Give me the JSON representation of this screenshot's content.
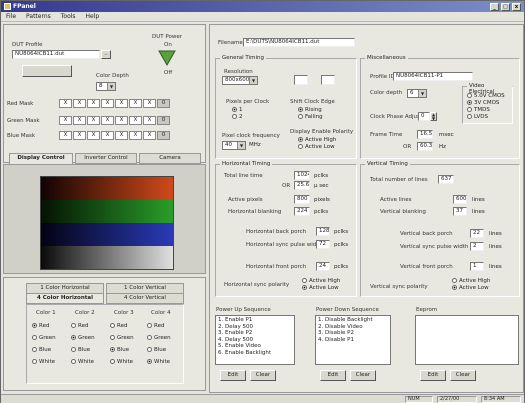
{
  "window": {
    "title": "FPanel",
    "min": "_",
    "max": "□",
    "close": "x"
  },
  "menu": [
    "File",
    "Patterns",
    "Tools",
    "Help"
  ],
  "left": {
    "dut_profile_label": "DUT Profile",
    "dut_profile_value": "NU8064ICB11.dut",
    "dut_power_label": "DUT Power",
    "dut_power_on": "On",
    "dut_power_off": "Off",
    "color_depth_label": "Color Depth",
    "color_depth_value": "8",
    "mask_rows": [
      {
        "label": "Red Mask",
        "cells": [
          "X",
          "X",
          "X",
          "X",
          "X",
          "X",
          "X",
          "0"
        ]
      },
      {
        "label": "Green Mask",
        "cells": [
          "X",
          "X",
          "X",
          "X",
          "X",
          "X",
          "X",
          "0"
        ]
      },
      {
        "label": "Blue Mask",
        "cells": [
          "X",
          "X",
          "X",
          "X",
          "X",
          "X",
          "X",
          "0"
        ]
      }
    ],
    "tabs": [
      "Display Control",
      "Inverter Control",
      "Camera"
    ],
    "pattern_tabs_top": [
      "1 Color Horizontal",
      "1 Color Vertical"
    ],
    "pattern_tabs_bottom": [
      "4 Color Horizontal",
      "4 Color Vertical"
    ],
    "color_columns": [
      {
        "title": "Color 1",
        "options": [
          "Red",
          "Green",
          "Blue",
          "White"
        ],
        "selected": "Red"
      },
      {
        "title": "Color 2",
        "options": [
          "Red",
          "Green",
          "Blue",
          "White"
        ],
        "selected": "Green"
      },
      {
        "title": "Color 3",
        "options": [
          "Red",
          "Green",
          "Blue",
          "White"
        ],
        "selected": "Blue"
      },
      {
        "title": "Color 4",
        "options": [
          "Red",
          "Green",
          "Blue",
          "White"
        ],
        "selected": "White"
      }
    ]
  },
  "filename_label": "Filename",
  "filename_value": "E:\\DUTS\\NU8064ICB11.dut",
  "general_timing": {
    "title": "General Timing",
    "resolution_label": "Resolution",
    "resolution_value": "800x600",
    "pixels_per_clock_label": "Pixels per Clock",
    "ppc_options": [
      "1",
      "2"
    ],
    "ppc_selected": "1",
    "shift_clock_label": "Shift Clock Edge",
    "edge_options": [
      "Rising",
      "Falling"
    ],
    "edge_selected": "Rising",
    "pixel_freq_label": "Pixel clock frequency",
    "pixel_freq_value": "40",
    "pixel_freq_unit": "MHz",
    "display_enable_label": "Display Enable Polarity",
    "de_options": [
      "Active High",
      "Active Low"
    ],
    "de_selected": "Active High"
  },
  "misc": {
    "title": "Miscellaneous",
    "profile_id_label": "Profile ID",
    "profile_id_value": "NU8064ICB11-P1",
    "color_depth_label": "Color depth",
    "color_depth_value": "6",
    "clock_phase_label": "Clock Phase Adjust",
    "clock_phase_value": "0",
    "video_title": "Video Electrical",
    "video_options": [
      "5.0V CMOS",
      "3V CMOS",
      "TMDS",
      "LVDS"
    ],
    "video_selected": "3V CMOS",
    "frame_time_label": "Frame Time",
    "frame_time_value": "16.57",
    "frame_time_unit": "msec",
    "frame_rate_prefix": "OR",
    "frame_rate_value": "60.35",
    "frame_rate_unit": "Hz"
  },
  "horizontal": {
    "title": "Horizontal Timing",
    "total_line_label": "Total line time",
    "total_line_value": "1024",
    "total_line_unit": "pclks",
    "or_label": "OR",
    "or_value": "25.6",
    "or_unit": "µ sec",
    "active_label": "Active pixels",
    "active_value": "800",
    "active_unit": "pixels",
    "blanking_label": "Horizontal blanking",
    "blanking_value": "224",
    "blanking_unit": "pclks",
    "back_porch_label": "Horizontal back porch",
    "back_porch_value": "128",
    "back_porch_unit": "pclks",
    "sync_width_label": "Horizontal sync pulse width",
    "sync_width_value": "72",
    "sync_width_unit": "pclks",
    "front_porch_label": "Horizontal front porch",
    "front_porch_value": "24",
    "front_porch_unit": "pclks",
    "polarity_label": "Horizontal sync polarity",
    "polarity_options": [
      "Active High",
      "Active Low"
    ],
    "polarity_selected": "Active Low"
  },
  "vertical": {
    "title": "Vertical Timing",
    "total_label": "Total number of lines",
    "total_value": "637",
    "active_label": "Active lines",
    "active_value": "600",
    "active_unit": "lines",
    "blanking_label": "Vertical blanking",
    "blanking_value": "37",
    "blanking_unit": "lines",
    "back_porch_label": "Vertical back porch",
    "back_porch_value": "22",
    "back_porch_unit": "lines",
    "sync_width_label": "Vertical sync pulse width",
    "sync_width_value": "2",
    "sync_width_unit": "lines",
    "front_porch_label": "Vertical front porch",
    "front_porch_value": "1",
    "front_porch_unit": "lines",
    "polarity_label": "Vertical sync polarity",
    "polarity_options": [
      "Active High",
      "Active Low"
    ],
    "polarity_selected": "Active Low"
  },
  "power_up": {
    "title": "Power Up Sequence",
    "items": [
      "1. Enable P1",
      "2. Delay 500",
      "3. Enable P2",
      "4. Delay 500",
      "5. Enable Video",
      "6. Enable Backlight"
    ],
    "edit": "Edit",
    "clear": "Clear"
  },
  "power_down": {
    "title": "Power Down Sequence",
    "items": [
      "1. Disable Backlight",
      "2. Disable Video",
      "3. Disable P2",
      "4. Disable P1"
    ],
    "edit": "Edit",
    "clear": "Clear"
  },
  "eeprom": {
    "title": "Eeprom",
    "items": [],
    "edit": "Edit",
    "clear": "Clear"
  },
  "status": {
    "mode": "NUM",
    "date": "2/27/00",
    "time": "8:34 AM"
  },
  "colors": {
    "led": "#5aa03c",
    "titlebar": "#35398e"
  }
}
